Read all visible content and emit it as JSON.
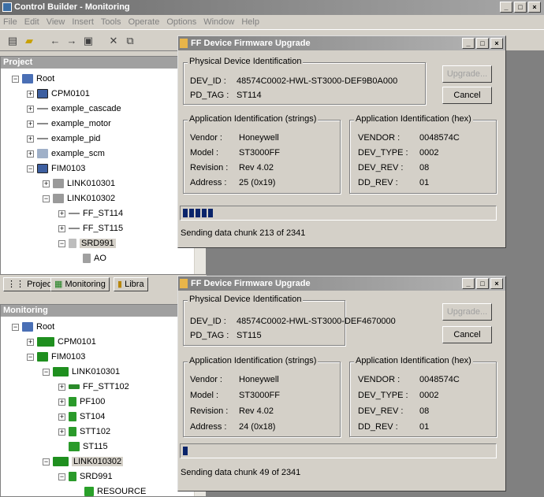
{
  "app": {
    "title": "Control Builder - Monitoring"
  },
  "menu": [
    "File",
    "Edit",
    "View",
    "Insert",
    "Tools",
    "Operate",
    "Options",
    "Window",
    "Help"
  ],
  "project_panel": {
    "title": "Project",
    "nodes": [
      {
        "label": "Root",
        "pm": "−",
        "icon": "root"
      },
      {
        "label": "CPM0101",
        "pm": "+",
        "icon": "cpm"
      },
      {
        "label": "example_cascade",
        "pm": "+",
        "icon": "cm"
      },
      {
        "label": "example_motor",
        "pm": "+",
        "icon": "cm"
      },
      {
        "label": "example_pid",
        "pm": "+",
        "icon": "cm"
      },
      {
        "label": "example_scm",
        "pm": "+",
        "icon": "scm"
      },
      {
        "label": "FIM0103",
        "pm": "−",
        "icon": "cpm"
      },
      {
        "label": "LINK010301",
        "pm": "+",
        "icon": "link"
      },
      {
        "label": "LINK010302",
        "pm": "−",
        "icon": "link"
      },
      {
        "label": "FF_ST114",
        "pm": "+",
        "icon": "cm"
      },
      {
        "label": "FF_ST115",
        "pm": "+",
        "icon": "cm"
      },
      {
        "label": "SRD991",
        "pm": "−",
        "icon": "dev"
      },
      {
        "label": "AO",
        "pm": "",
        "icon": "ao"
      }
    ]
  },
  "tabs": [
    "Project",
    "Monitoring",
    "Libra"
  ],
  "monitoring_panel": {
    "title": "Monitoring",
    "nodes": [
      {
        "label": "Root",
        "pm": "−",
        "icon": "root"
      },
      {
        "label": "CPM0101",
        "pm": "+",
        "icon": "cpm"
      },
      {
        "label": "FIM0103",
        "pm": "−",
        "icon": "cpm"
      },
      {
        "label": "LINK010301",
        "pm": "−",
        "icon": "link"
      },
      {
        "label": "FF_STT102",
        "pm": "+",
        "icon": "cm"
      },
      {
        "label": "PF100",
        "pm": "+",
        "icon": "dev"
      },
      {
        "label": "ST104",
        "pm": "+",
        "icon": "dev"
      },
      {
        "label": "STT102",
        "pm": "+",
        "icon": "dev"
      },
      {
        "label": "ST115",
        "pm": "",
        "icon": "unk"
      },
      {
        "label": "LINK010302",
        "pm": "−",
        "icon": "link"
      },
      {
        "label": "SRD991",
        "pm": "−",
        "icon": "dev"
      },
      {
        "label": "RESOURCE",
        "pm": "",
        "icon": "res"
      }
    ]
  },
  "dialogs": [
    {
      "title": "FF Device Firmware Upgrade",
      "physical_group": "Physical Device Identification",
      "dev_id_label": "DEV_ID :",
      "dev_id": "48574C0002-HWL-ST3000-DEF9B0A000",
      "pd_tag_label": "PD_TAG :",
      "pd_tag": "ST114",
      "upgrade_label": "Upgrade...",
      "cancel_label": "Cancel",
      "app_strings_group": "Application Identification (strings)",
      "vendor_label": "Vendor :",
      "vendor": "Honeywell",
      "model_label": "Model :",
      "model": "ST3000FF",
      "revision_label": "Revision :",
      "revision": "Rev 4.02",
      "address_label": "Address :",
      "address": "25 (0x19)",
      "app_hex_group": "Application Identification (hex)",
      "vendor_hex_label": "VENDOR :",
      "vendor_hex": "0048574C",
      "dev_type_label": "DEV_TYPE :",
      "dev_type": "0002",
      "dev_rev_label": "DEV_REV :",
      "dev_rev": "08",
      "dd_rev_label": "DD_REV :",
      "dd_rev": "01",
      "progress": 0.091,
      "status": "Sending data chunk  213 of 2341"
    },
    {
      "title": "FF Device Firmware Upgrade",
      "physical_group": "Physical Device Identification",
      "dev_id_label": "DEV_ID :",
      "dev_id": "48574C0002-HWL-ST3000-DEF4670000",
      "pd_tag_label": "PD_TAG :",
      "pd_tag": "ST115",
      "upgrade_label": "Upgrade...",
      "cancel_label": "Cancel",
      "app_strings_group": "Application Identification (strings)",
      "vendor_label": "Vendor :",
      "vendor": "Honeywell",
      "model_label": "Model :",
      "model": "ST3000FF",
      "revision_label": "Revision :",
      "revision": "Rev 4.02",
      "address_label": "Address :",
      "address": "24 (0x18)",
      "app_hex_group": "Application Identification (hex)",
      "vendor_hex_label": "VENDOR :",
      "vendor_hex": "0048574C",
      "dev_type_label": "DEV_TYPE :",
      "dev_type": "0002",
      "dev_rev_label": "DEV_REV :",
      "dev_rev": "08",
      "dd_rev_label": "DD_REV :",
      "dd_rev": "01",
      "progress": 0.021,
      "status": "Sending data chunk  49 of 2341"
    }
  ]
}
